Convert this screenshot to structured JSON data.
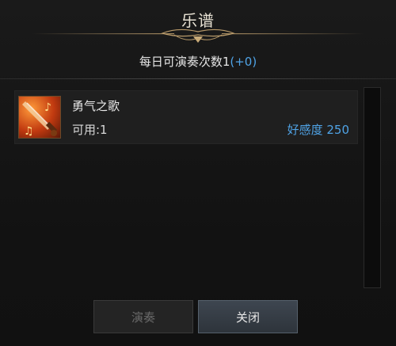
{
  "window": {
    "title": "乐谱"
  },
  "daily": {
    "label": "每日可演奏次数1",
    "bonus": "(+0)"
  },
  "items": [
    {
      "icon": "sword-music-note-icon",
      "name": "勇气之歌",
      "available": "可用:1",
      "favor": "好感度 250"
    }
  ],
  "buttons": {
    "play": "演奏",
    "close": "关闭"
  },
  "colors": {
    "accent": "#4fa3e6",
    "ornament": "#b89a6a"
  }
}
